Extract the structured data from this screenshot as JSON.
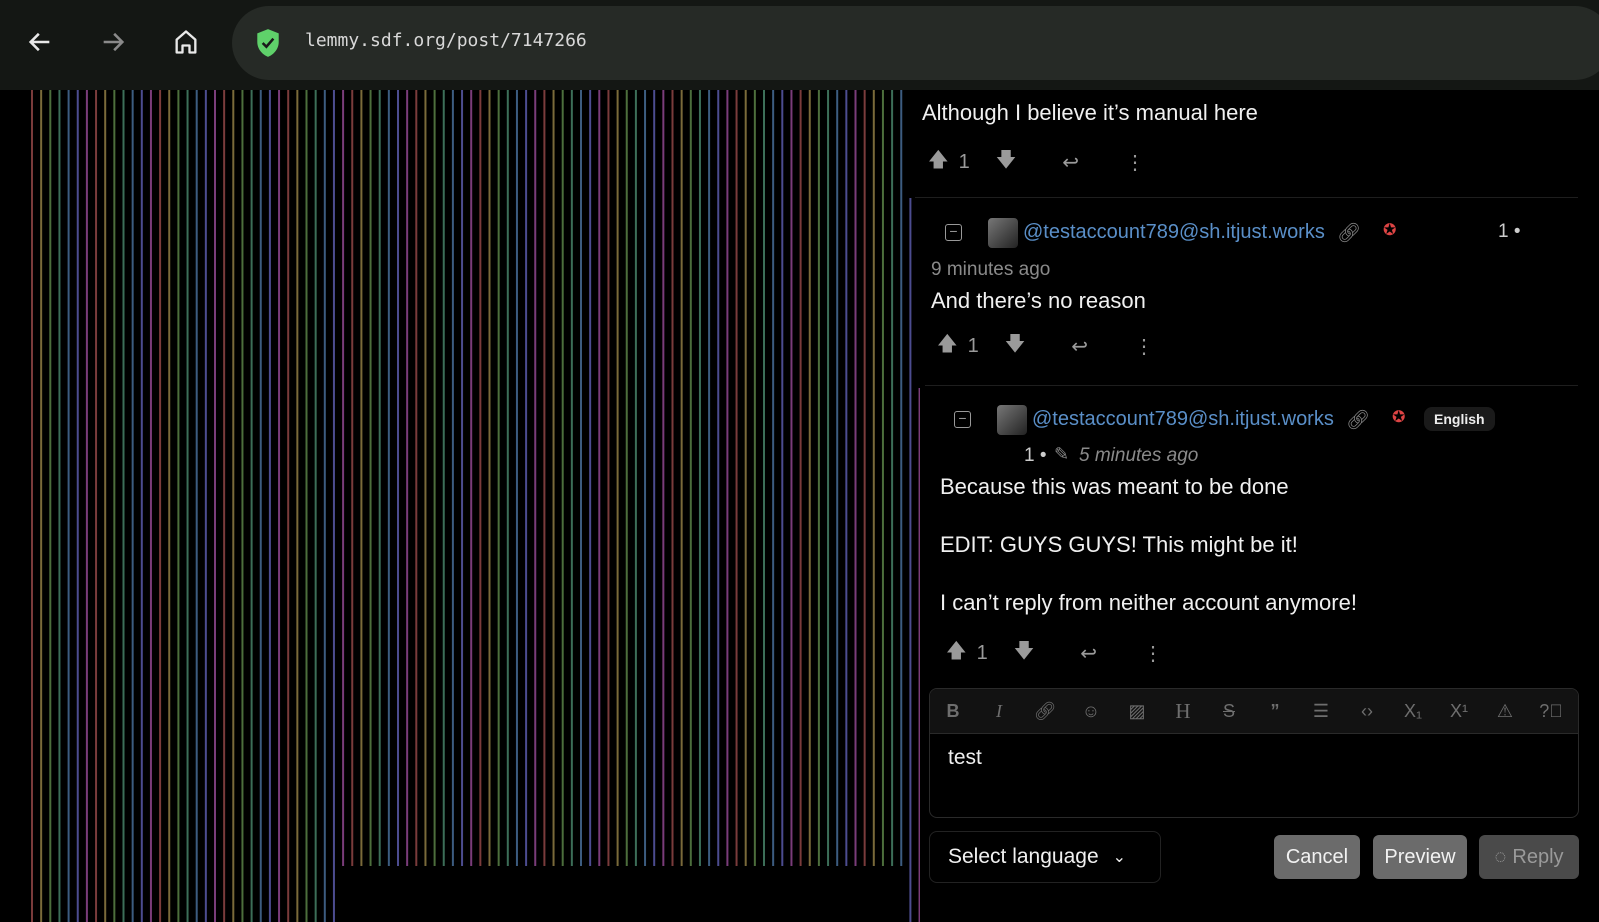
{
  "browser": {
    "url": "lemmy.sdf.org/post/7147266",
    "back_icon": "arrow-left-icon",
    "forward_icon": "arrow-right-icon",
    "home_icon": "home-icon",
    "secure_icon": "shield-check-icon",
    "secure_color": "#5fd16a"
  },
  "stripe_colors": [
    "#7a3b3b",
    "#7a6a3a",
    "#4c6e3c",
    "#3c6e58",
    "#3c5c80",
    "#4c4c90",
    "#7a3c7a"
  ],
  "comments": [
    {
      "body": "Although I believe it’s manual here",
      "score": "1"
    },
    {
      "user": "@testaccount789@sh.itjust.works",
      "score_meta": "1 •",
      "time": "9 minutes ago",
      "body": "And there’s no reason",
      "score": "1"
    },
    {
      "user": "@testaccount789@sh.itjust.works",
      "language": "English",
      "score_meta": "1 •",
      "time": "5 minutes ago",
      "body": [
        "Because this was meant to be done",
        "EDIT: GUYS GUYS! This might be it!",
        "I can’t reply from neither account anymore!"
      ],
      "score": "1"
    }
  ],
  "editor": {
    "toolbar": [
      "bold",
      "italic",
      "link",
      "emoji",
      "image",
      "header",
      "strikethrough",
      "quote",
      "list",
      "code",
      "subscript",
      "superscript",
      "spoiler",
      "help"
    ],
    "text": "test",
    "language_select": "Select language",
    "cancel": "Cancel",
    "preview": "Preview",
    "reply": "Reply"
  }
}
